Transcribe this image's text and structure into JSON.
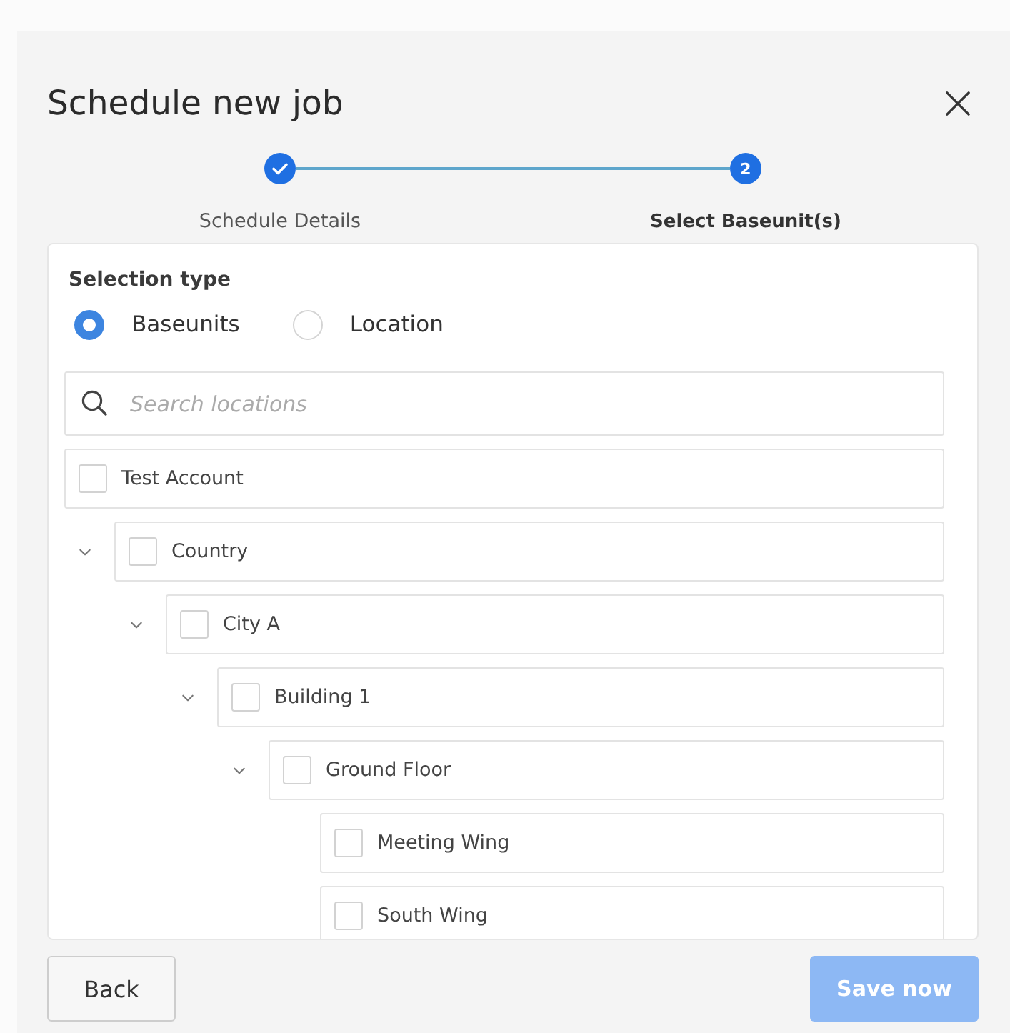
{
  "dialog": {
    "title": "Schedule new job"
  },
  "steps": [
    {
      "label": "Schedule Details",
      "kind": "done"
    },
    {
      "label": "Select Baseunit(s)",
      "kind": "current",
      "number": "2"
    }
  ],
  "selection_type": {
    "label": "Selection type",
    "options": [
      {
        "label": "Baseunits",
        "selected": true
      },
      {
        "label": "Location",
        "selected": false
      }
    ]
  },
  "search": {
    "placeholder": "Search locations"
  },
  "tree": [
    {
      "label": "Test Account",
      "checked": false,
      "children": [
        {
          "label": "Country",
          "checked": false,
          "expanded": true,
          "children": [
            {
              "label": "City A",
              "checked": false,
              "expanded": true,
              "children": [
                {
                  "label": "Building 1",
                  "checked": false,
                  "expanded": true,
                  "children": [
                    {
                      "label": "Ground Floor",
                      "checked": false,
                      "expanded": true,
                      "children": [
                        {
                          "label": "Meeting Wing",
                          "checked": false
                        },
                        {
                          "label": "South Wing",
                          "checked": false
                        }
                      ]
                    }
                  ]
                }
              ]
            }
          ]
        }
      ]
    }
  ],
  "buttons": [
    {
      "label": "Back",
      "kind": "secondary",
      "disabled": false
    },
    {
      "label": "Save now",
      "kind": "primary",
      "disabled": true
    }
  ]
}
